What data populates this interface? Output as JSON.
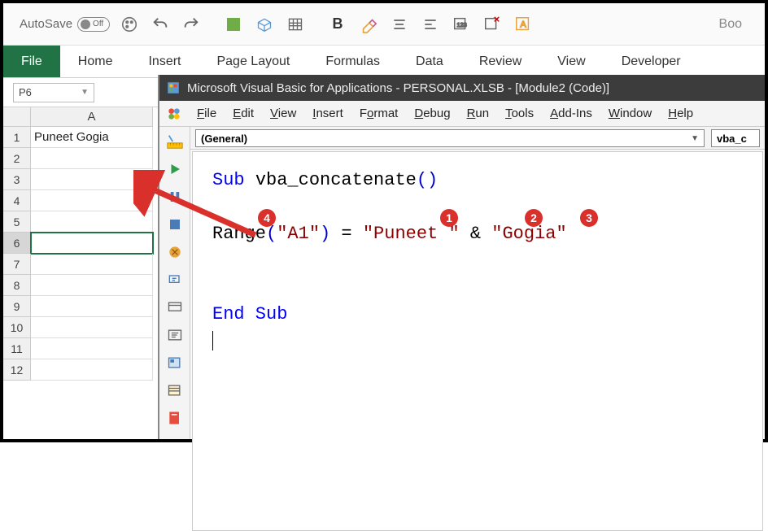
{
  "autosave": {
    "label": "AutoSave",
    "state": "Off"
  },
  "book": "Boo",
  "ribbon": [
    "File",
    "Home",
    "Insert",
    "Page Layout",
    "Formulas",
    "Data",
    "Review",
    "View",
    "Developer"
  ],
  "namebox": "P6",
  "grid": {
    "col_header": "A",
    "rows": [
      {
        "n": "1",
        "value": "Puneet Gogia"
      },
      {
        "n": "2",
        "value": ""
      },
      {
        "n": "3",
        "value": ""
      },
      {
        "n": "4",
        "value": ""
      },
      {
        "n": "5",
        "value": ""
      },
      {
        "n": "6",
        "value": ""
      },
      {
        "n": "7",
        "value": ""
      },
      {
        "n": "8",
        "value": ""
      },
      {
        "n": "9",
        "value": ""
      },
      {
        "n": "10",
        "value": ""
      },
      {
        "n": "11",
        "value": ""
      },
      {
        "n": "12",
        "value": ""
      }
    ],
    "active_row": 6
  },
  "vba": {
    "title": "Microsoft Visual Basic for Applications - PERSONAL.XLSB - [Module2 (Code)]",
    "menu": [
      "File",
      "Edit",
      "View",
      "Insert",
      "Format",
      "Debug",
      "Run",
      "Tools",
      "Add-Ins",
      "Window",
      "Help"
    ],
    "dd_left": "(General)",
    "dd_right": "vba_c",
    "code": {
      "line1_kw": "Sub ",
      "line1_name": "vba_concatenate",
      "line1_paren": "()",
      "line2_range": "Range",
      "line2_p1": "(",
      "line2_arg": "\"A1\"",
      "line2_p2": ")",
      "line2_eq": " = ",
      "line2_s1": "\"Puneet \"",
      "line2_amp": " & ",
      "line2_s2": "\"Gogia\"",
      "line3": "End Sub"
    }
  },
  "badges": {
    "b1": "1",
    "b2": "2",
    "b3": "3",
    "b4": "4"
  }
}
